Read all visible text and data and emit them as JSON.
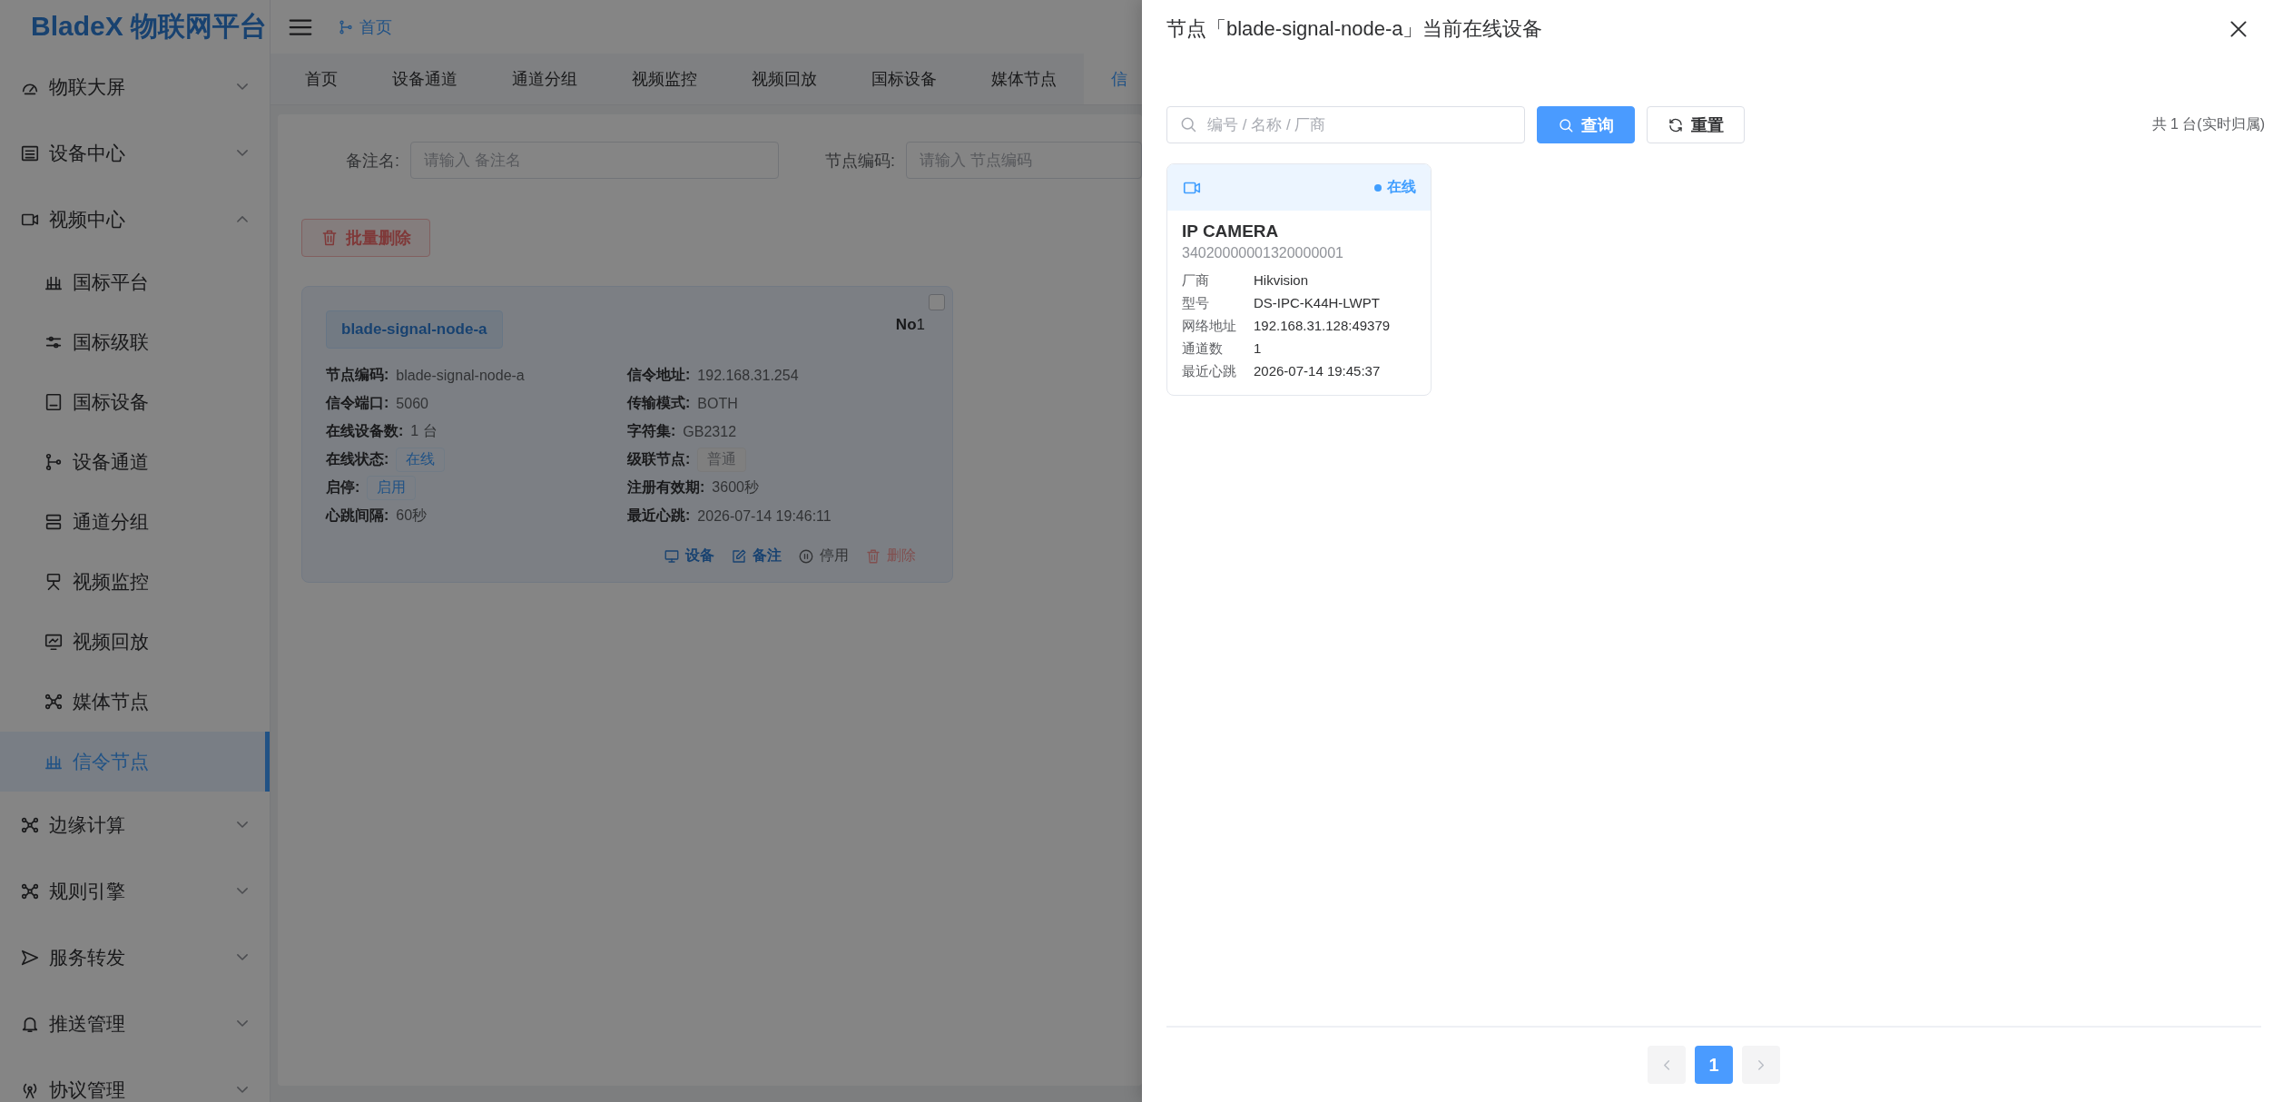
{
  "app": {
    "logo": "BladeX 物联网平台",
    "breadcrumb": "首页"
  },
  "sidebar": {
    "items": [
      {
        "label": "物联大屏",
        "expanded": false
      },
      {
        "label": "设备中心",
        "expanded": false
      },
      {
        "label": "视频中心",
        "expanded": true,
        "children": [
          {
            "label": "国标平台",
            "selected": false
          },
          {
            "label": "国标级联",
            "selected": false
          },
          {
            "label": "国标设备",
            "selected": false
          },
          {
            "label": "设备通道",
            "selected": false
          },
          {
            "label": "通道分组",
            "selected": false
          },
          {
            "label": "视频监控",
            "selected": false
          },
          {
            "label": "视频回放",
            "selected": false
          },
          {
            "label": "媒体节点",
            "selected": false
          },
          {
            "label": "信令节点",
            "selected": true
          }
        ]
      },
      {
        "label": "边缘计算",
        "expanded": false
      },
      {
        "label": "规则引擎",
        "expanded": false
      },
      {
        "label": "服务转发",
        "expanded": false
      },
      {
        "label": "推送管理",
        "expanded": false
      },
      {
        "label": "协议管理",
        "expanded": false
      }
    ]
  },
  "tabs": [
    {
      "label": "首页",
      "selected": false
    },
    {
      "label": "设备通道",
      "selected": false
    },
    {
      "label": "通道分组",
      "selected": false
    },
    {
      "label": "视频监控",
      "selected": false
    },
    {
      "label": "视频回放",
      "selected": false
    },
    {
      "label": "国标设备",
      "selected": false
    },
    {
      "label": "媒体节点",
      "selected": false
    },
    {
      "label": "信",
      "selected": true
    }
  ],
  "filters": [
    {
      "label": "备注名:",
      "placeholder": "请输入 备注名"
    },
    {
      "label": "节点编码:",
      "placeholder": "请输入 节点编码"
    }
  ],
  "batch_delete": "批量删除",
  "nodes": [
    {
      "name": "blade-signal-node-a",
      "number": "**No**1",
      "checked": false,
      "fields": [
        {
          "label": "节点编码:",
          "value": "blade-signal-node-a",
          "kind": "text"
        },
        {
          "label": "信令地址:",
          "value": "192.168.31.254",
          "kind": "text"
        },
        {
          "label": "信令端口:",
          "value": "5060",
          "kind": "text"
        },
        {
          "label": "传输模式:",
          "value": "BOTH",
          "kind": "text"
        },
        {
          "label": "在线设备数:",
          "value": "1 台",
          "kind": "text"
        },
        {
          "label": "字符集:",
          "value": "GB2312",
          "kind": "text"
        },
        {
          "label": "在线状态:",
          "value": "在线",
          "kind": "tag"
        },
        {
          "label": "级联节点:",
          "value": "普通",
          "kind": "infotag"
        },
        {
          "label": "启停:",
          "value": "启用",
          "kind": "tag"
        },
        {
          "label": "注册有效期:",
          "value": "3600秒",
          "kind": "text"
        },
        {
          "label": "心跳间隔:",
          "value": "60秒",
          "kind": "text"
        },
        {
          "label": "最近心跳:",
          "value": "2026-07-14 19:46:11",
          "kind": "text"
        }
      ],
      "actions": [
        {
          "label": "设备",
          "kind": "primary"
        },
        {
          "label": "备注",
          "kind": "primary"
        },
        {
          "label": "停用",
          "kind": "muted"
        },
        {
          "label": "删除",
          "kind": "danger"
        }
      ]
    }
  ],
  "drawer": {
    "title": "节点「blade-signal-node-a」当前在线设备",
    "search": {
      "placeholder": "编号 / 名称 / 厂商"
    },
    "buttons": [
      {
        "label": "查询",
        "kind": "primary"
      },
      {
        "label": "重置",
        "kind": "default"
      }
    ],
    "total": "共 1 台(实时归属)",
    "devices": [
      {
        "status": "在线",
        "online": true,
        "name": "IP CAMERA",
        "id": "34020000001320000001",
        "fields": [
          {
            "label": "厂商",
            "value": "Hikvision"
          },
          {
            "label": "型号",
            "value": "DS-IPC-K44H-LWPT"
          },
          {
            "label": "网络地址",
            "value": "192.168.31.128:49379"
          },
          {
            "label": "通道数",
            "value": "1"
          },
          {
            "label": "最近心跳",
            "value": "2026-07-14 19:45:37"
          }
        ]
      }
    ],
    "pagination": {
      "prev_disabled": true,
      "next_disabled": true,
      "pages": [
        {
          "label": "1",
          "selected": true
        }
      ]
    }
  }
}
